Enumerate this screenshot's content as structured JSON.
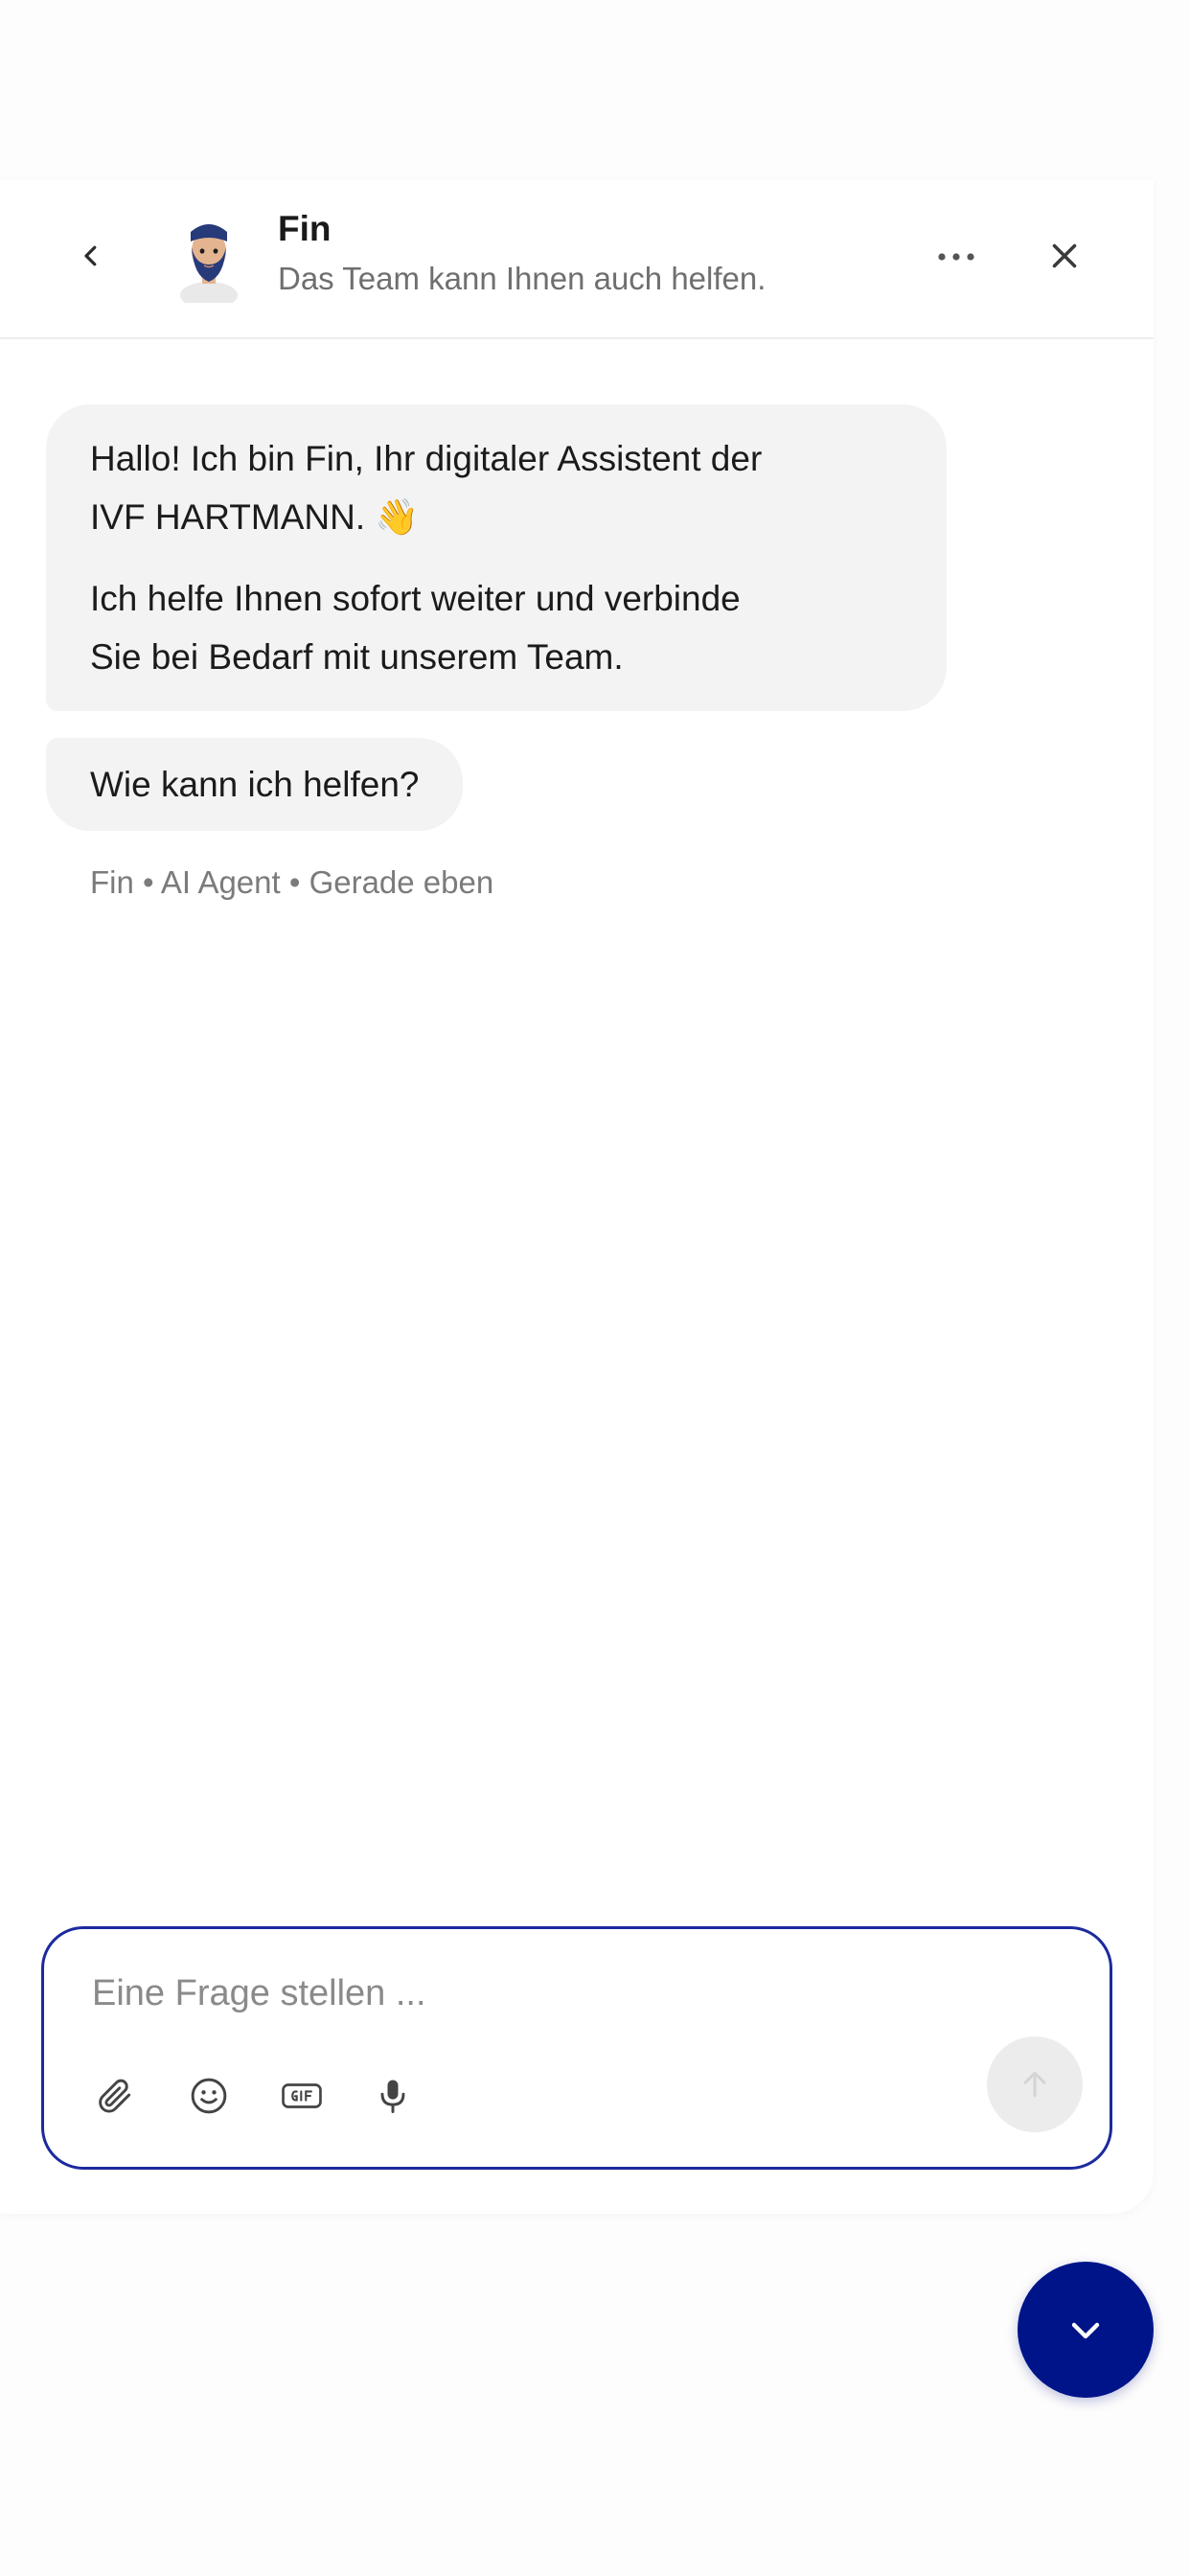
{
  "header": {
    "agent_name": "Fin",
    "agent_status": "Das Team kann Ihnen auch helfen."
  },
  "messages": [
    {
      "paragraphs": [
        "Hallo! Ich bin Fin, Ihr digitaler Assistent der",
        "IVF HARTMANN. 👋",
        "Ich helfe Ihnen sofort weiter und verbinde",
        "Sie bei Bedarf mit unserem Team."
      ]
    },
    {
      "text": "Wie kann ich helfen?"
    }
  ],
  "meta": "Fin • AI Agent • Gerade eben",
  "composer": {
    "placeholder": "Eine Frage stellen ...",
    "value": ""
  },
  "icons": {
    "back": "chevron-left-icon",
    "avatar": "bearded-man-avatar",
    "more": "more-horizontal-icon",
    "close": "close-icon",
    "attach": "paperclip-icon",
    "emoji": "smiley-icon",
    "gif": "gif-icon",
    "mic": "microphone-icon",
    "send": "arrow-up-icon",
    "launcher": "chevron-down-icon"
  },
  "colors": {
    "accent": "#001489",
    "composer_border": "#1c2a9e",
    "bubble_bg": "#f3f3f3",
    "muted_text": "#7b7b7b",
    "send_disabled_bg": "#ececec"
  }
}
